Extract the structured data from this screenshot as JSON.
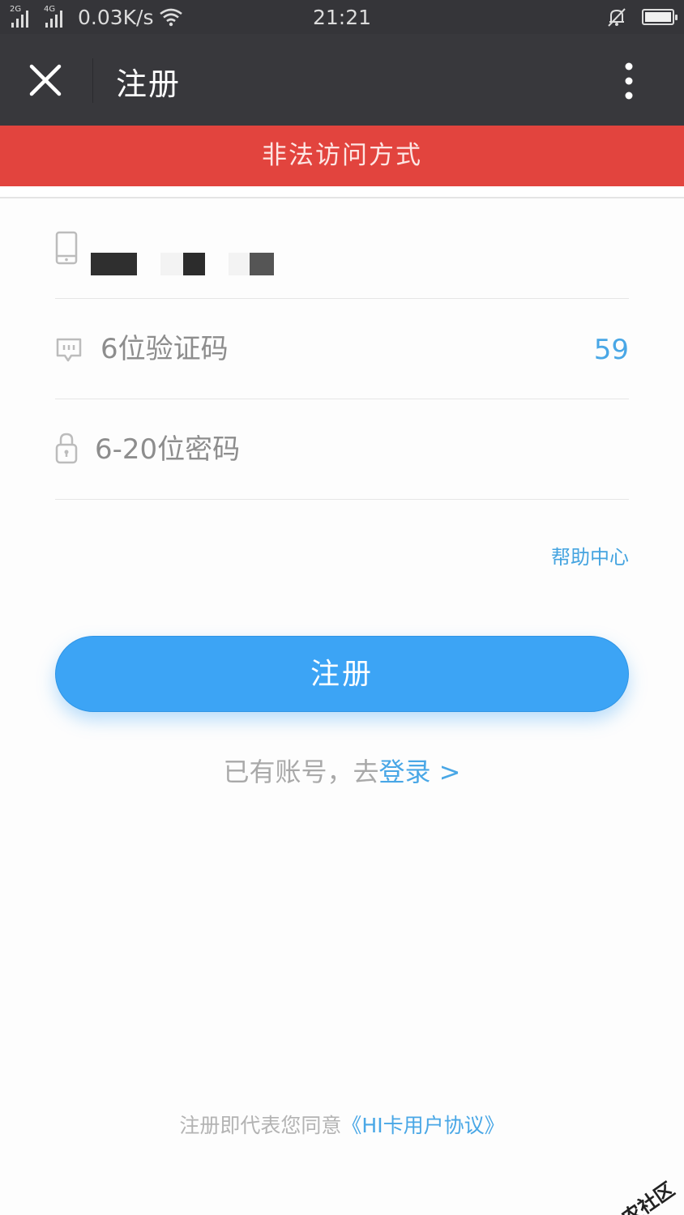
{
  "status_bar": {
    "signal_1_label": "2G",
    "signal_2_label": "4G",
    "net_speed": "0.03K/s",
    "time": "21:21"
  },
  "title_bar": {
    "title": "注册"
  },
  "banner": {
    "message": "非法访问方式"
  },
  "form": {
    "code_placeholder": "6位验证码",
    "countdown": "59",
    "password_placeholder": "6-20位密码"
  },
  "help_link": "帮助中心",
  "register_button": "注册",
  "login_prompt": {
    "prefix": "已有账号，去",
    "link": "登录 >"
  },
  "agreement": {
    "prefix": "注册即代表您同意",
    "link": "《HI卡用户协议》"
  },
  "watermark": "卡农社区",
  "colors": {
    "banner_red": "#e2443e",
    "accent_blue": "#3ca4f5",
    "link_blue": "#49a7e6",
    "title_bar": "#38383c"
  }
}
